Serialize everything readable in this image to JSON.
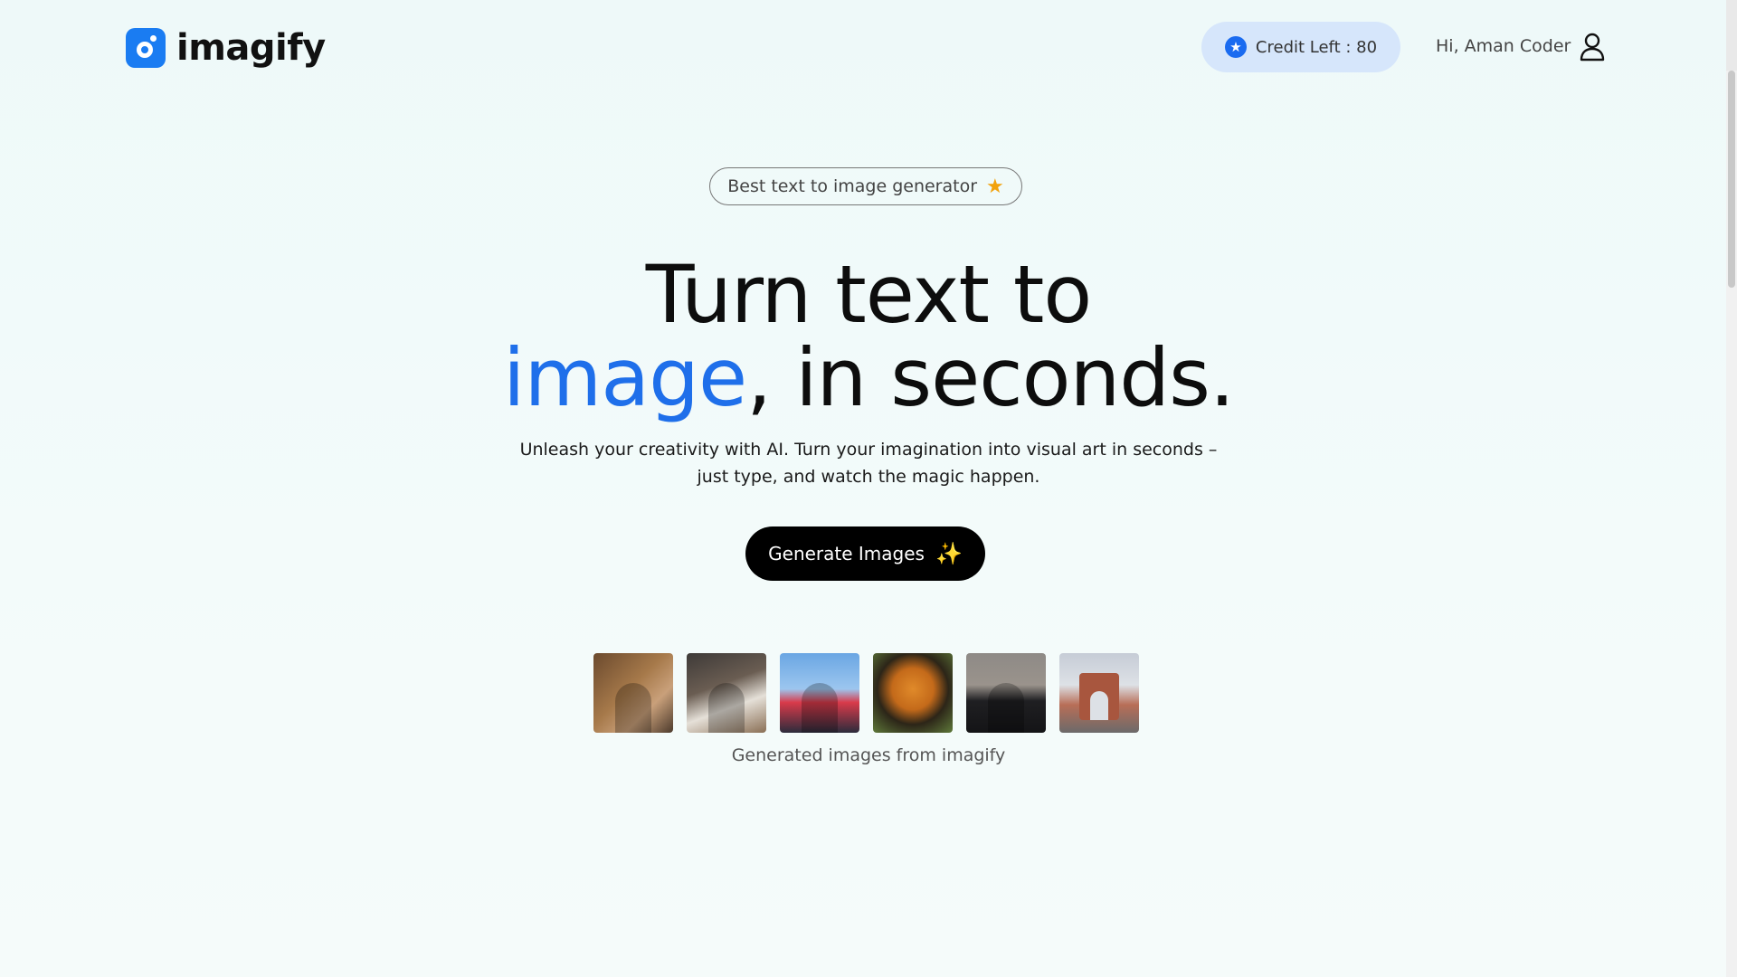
{
  "header": {
    "logo_text": "imagify",
    "credit_label": "Credit Left : 80",
    "greeting": "Hi, Aman Coder"
  },
  "hero": {
    "badge": "Best text to image generator",
    "headline_line1": "Turn text to",
    "headline_accent": "image",
    "headline_rest": ", in seconds.",
    "subtext_line1": "Unleash your creativity with AI. Turn your imagination into visual art in seconds –",
    "subtext_line2": "just type, and watch the magic happen.",
    "cta_label": "Generate Images",
    "caption": "Generated images from imagify"
  },
  "colors": {
    "brand": "#1a7cf2",
    "accent_text": "#1f6fea",
    "credit_pill_bg": "#d6e6fb",
    "cta_bg": "#000000"
  },
  "icons": {
    "credit": "star-badge-icon",
    "badge": "star-icon",
    "cta": "sparkle-icon",
    "user": "user-icon"
  }
}
